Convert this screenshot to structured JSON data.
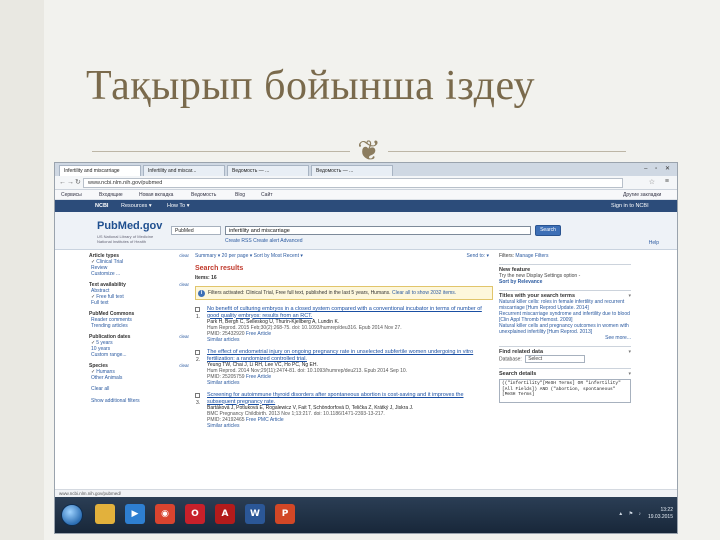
{
  "slide": {
    "title": "Тақырып бойынша іздеу",
    "divider_icon": "scroll-ornament-icon"
  },
  "browser": {
    "tabs": [
      "Infertility and miscarriage",
      "Infertility and miscar...",
      "Ведомость — ...",
      "Ведомость — ..."
    ],
    "url": "www.ncbi.nlm.nih.gov/pubmed",
    "bookmarks": [
      "Сервисы",
      "Входящие",
      "Новая вкладка",
      "Ведомость",
      "Blog",
      "Сайт",
      "Другие закладки"
    ]
  },
  "ncbi": {
    "logo": "NCBI",
    "resources": "Resources ▾",
    "how_to": "How To ▾",
    "signin": "Sign in to NCBI"
  },
  "pubmed": {
    "logo": "PubMed.gov",
    "logo_sub": "US National Library of Medicine National Institutes of Health",
    "database": "PubMed",
    "query": "infertility and miscarriage",
    "search_button": "Search",
    "links": "Create RSS   Create alert   Advanced",
    "help": "Help"
  },
  "left_filters": [
    {
      "title": "Article types",
      "clear": "clear",
      "items": [
        {
          "label": "Clinical Trial",
          "checked": true
        },
        {
          "label": "Review",
          "checked": false
        },
        {
          "label": "Customize ...",
          "checked": false
        }
      ]
    },
    {
      "title": "Text availability",
      "clear": "clear",
      "items": [
        {
          "label": "Abstract",
          "checked": false
        },
        {
          "label": "Free full text",
          "checked": true
        },
        {
          "label": "Full text",
          "checked": false
        }
      ]
    },
    {
      "title": "PubMed Commons",
      "clear": "",
      "items": [
        {
          "label": "Reader comments",
          "checked": false
        },
        {
          "label": "Trending articles",
          "checked": false
        }
      ]
    },
    {
      "title": "Publication dates",
      "clear": "clear",
      "items": [
        {
          "label": "5 years",
          "checked": true
        },
        {
          "label": "10 years",
          "checked": false
        },
        {
          "label": "Custom range...",
          "checked": false
        }
      ]
    },
    {
      "title": "Species",
      "clear": "clear",
      "items": [
        {
          "label": "Humans",
          "checked": true
        },
        {
          "label": "Other Animals",
          "checked": false
        }
      ]
    }
  ],
  "left_footer": {
    "clear_all": "Clear all",
    "show_more": "Show additional filters"
  },
  "results": {
    "display_bar": "Summary ▾  20 per page ▾  Sort by Most Recent ▾",
    "send_to": "Send to: ▾",
    "heading": "Search results",
    "count": "Items: 16",
    "notice_text": "Filters activated: Clinical Trial, Free full text, published in the last 5 years, Humans.",
    "notice_link": "Clear all to show 2032 items.",
    "items": [
      {
        "num": "1.",
        "title": "No benefit of culturing embryos in a closed system compared with a conventional incubator in terms of number of good quality embryos: results from an RCT.",
        "authors": "Park H, Bergh C, Selleskog U, Thurin-Kjellberg A, Lundin K.",
        "journal": "Hum Reprod. 2015 Feb;30(2):268-75. doi: 10.1093/humrep/deu316. Epub 2014 Nov 27.",
        "pmid": "PMID: 25432920",
        "free": "Free Article",
        "similar": "Similar articles"
      },
      {
        "num": "2.",
        "title": "The effect of endometrial injury on ongoing pregnancy rate in unselected subfertile women undergoing in vitro fertilization: a randomized controlled trial.",
        "authors": "Yeung TW, Chai J, Li RH, Lee VC, Ho PC, Ng EH.",
        "journal": "Hum Reprod. 2014 Nov;29(11):2474-81. doi: 10.1093/humrep/deu213. Epub 2014 Sep 10.",
        "pmid": "PMID: 25205759",
        "free": "Free Article",
        "similar": "Similar articles"
      },
      {
        "num": "3.",
        "title": "Screening for autoimmune thyroid disorders after spontaneous abortion is cost-saving and it improves the subsequent pregnancy rate.",
        "authors": "Bartáková J, Potluková E, Rogalewicz V, Fait T, Schöndorfová D, Telička Z, Krátký J, Jiskra J.",
        "journal": "BMC Pregnancy Childbirth. 2013 Nov 1;13:217. doi: 10.1186/1471-2393-13-217.",
        "pmid": "PMID: 24192465",
        "free": "Free PMC Article",
        "similar": "Similar articles"
      }
    ]
  },
  "right_col": {
    "filters_label": "Filters:",
    "manage_filters": "Manage Filters",
    "new_feature": {
      "title": "New feature",
      "text": "Try the new Display Settings option -",
      "link": "Sort by Relevance"
    },
    "titles_box": {
      "title": "Titles with your search terms",
      "items": [
        "Natural killer cells: roles in female infertility and recurrent miscarriage [Hum Reprod Update. 2014]",
        "Recurrent miscarriage syndrome and infertility due to blood [Clin Appl Thromb Hemost. 2009]",
        "Natural killer cells and pregnancy outcomes in women with unexplained infertility [Hum Reprod. 2013]"
      ],
      "see_more": "See more..."
    },
    "related": {
      "title": "Find related data",
      "db_label": "Database:",
      "db_value": "Select"
    },
    "search_details": {
      "title": "Search details",
      "text": "((\"infertility\"[MeSH Terms] OR \"infertility\"[All Fields]) AND (\"abortion, spontaneous\"[MeSH Terms]"
    }
  },
  "status": {
    "url": "www.ncbi.nlm.nih.gov/pubmed/"
  },
  "taskbar": {
    "apps": [
      {
        "icon": "folder-icon",
        "label": "",
        "color": "#e2b13c"
      },
      {
        "icon": "media-player-icon",
        "label": "▶",
        "color": "#2e7fd1"
      },
      {
        "icon": "chrome-icon",
        "label": "◉",
        "color": "#d9442f"
      },
      {
        "icon": "opera-icon",
        "label": "O",
        "color": "#c8202a"
      },
      {
        "icon": "acrobat-icon",
        "label": "A",
        "color": "#b31b1b"
      },
      {
        "icon": "word-icon",
        "label": "W",
        "color": "#2b5797"
      },
      {
        "icon": "powerpoint-icon",
        "label": "P",
        "color": "#d24726"
      }
    ],
    "time": "13:22",
    "date": "19.03.2015"
  }
}
